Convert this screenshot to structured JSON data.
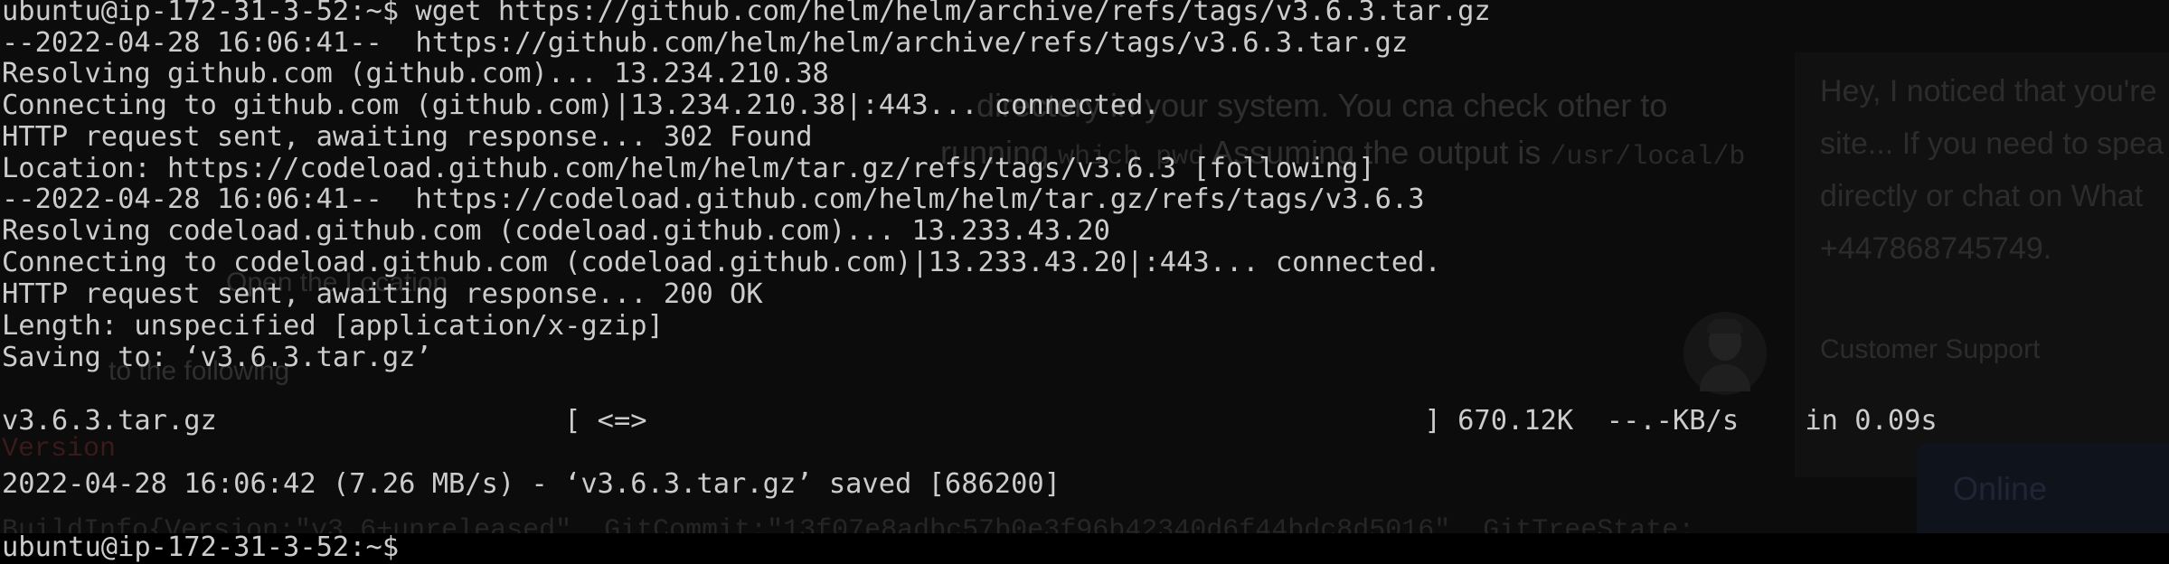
{
  "background_page": {
    "article_line_1": "directory in your system. You cna check other to",
    "article_line_2_prefix": "running",
    "article_line_2_code": "which pwd",
    "article_line_2_suffix": "Assuming the output is",
    "article_line_2_path": "/usr/local/b",
    "faint_label_1": "Open the Location",
    "faint_label_2": "Version",
    "faint_label_3": "to the following",
    "faint_code": "BuildInfo{Version:\"v3.6+unreleased\", GitCommit:\"13f07e8adbc57b0e3f96b42340d6f44bdc8d5016\", GitTreeState:",
    "chat": {
      "message_line_1": "Hey, I noticed that you're",
      "message_line_2": "site... If you need to spea",
      "message_line_3": "directly or chat on What",
      "message_line_4": "+447868745749.",
      "agent_label": "Customer Support",
      "online_label": "Online"
    }
  },
  "terminal": {
    "lines": [
      "ubuntu@ip-172-31-3-52:~$ wget https://github.com/helm/helm/archive/refs/tags/v3.6.3.tar.gz",
      "--2022-04-28 16:06:41--  https://github.com/helm/helm/archive/refs/tags/v3.6.3.tar.gz",
      "Resolving github.com (github.com)... 13.234.210.38",
      "Connecting to github.com (github.com)|13.234.210.38|:443... connected.",
      "HTTP request sent, awaiting response... 302 Found",
      "Location: https://codeload.github.com/helm/helm/tar.gz/refs/tags/v3.6.3 [following]",
      "--2022-04-28 16:06:41--  https://codeload.github.com/helm/helm/tar.gz/refs/tags/v3.6.3",
      "Resolving codeload.github.com (codeload.github.com)... 13.233.43.20",
      "Connecting to codeload.github.com (codeload.github.com)|13.233.43.20|:443... connected.",
      "HTTP request sent, awaiting response... 200 OK",
      "Length: unspecified [application/x-gzip]",
      "Saving to: ‘v3.6.3.tar.gz’",
      "",
      "v3.6.3.tar.gz                     [ <=>                                               ] 670.12K  --.-KB/s    in 0.09s",
      "",
      "2022-04-28 16:06:42 (7.26 MB/s) - ‘v3.6.3.tar.gz’ saved [686200]",
      "",
      "ubuntu@ip-172-31-3-52:~$"
    ]
  }
}
